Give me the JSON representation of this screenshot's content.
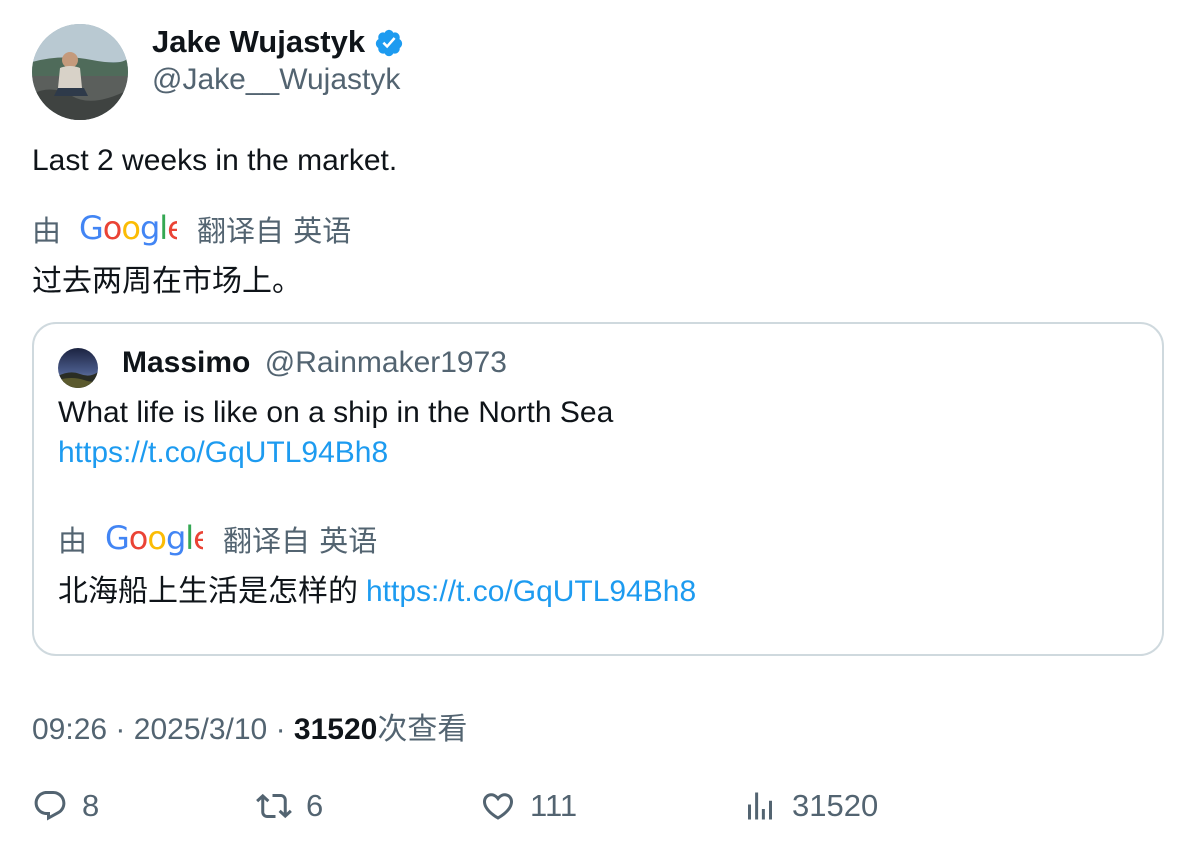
{
  "author": {
    "name": "Jake Wujastyk",
    "handle": "@Jake__Wujastyk",
    "verified": true
  },
  "tweet": {
    "text": "Last 2 weeks in the market.",
    "translation": {
      "by_label": "由",
      "provider": "Google",
      "translated_from_label": "翻译自 英语",
      "translated_text": "过去两周在市场上。"
    }
  },
  "quote": {
    "name": "Massimo",
    "handle": "@Rainmaker1973",
    "text": "What life is like on a ship in the North Sea",
    "link": "https://t.co/GqUTL94Bh8",
    "translation": {
      "by_label": "由",
      "provider": "Google",
      "translated_from_label": "翻译自 英语",
      "translated_text": "北海船上生活是怎样的",
      "link": "https://t.co/GqUTL94Bh8"
    }
  },
  "meta": {
    "time": "09:26",
    "separator": "·",
    "date": "2025/3/10",
    "views_count": "31520",
    "views_label": "次查看"
  },
  "actions": {
    "replies": "8",
    "retweets": "6",
    "likes": "111",
    "views": "31520"
  },
  "colors": {
    "text": "#0f1419",
    "secondary": "#536471",
    "link": "#1d9bf0",
    "verified": "#1d9bf0",
    "border": "#cfd9de"
  }
}
